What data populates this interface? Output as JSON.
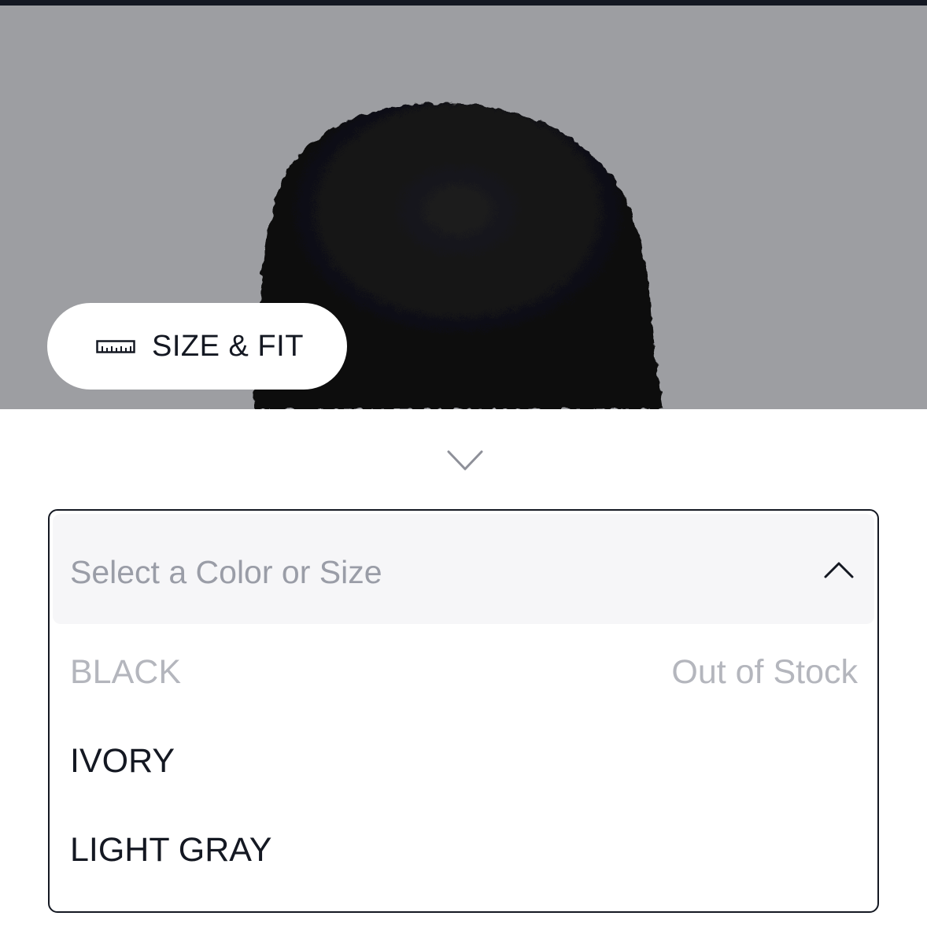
{
  "product": {
    "image_alt": "black boucle beanie",
    "size_fit_label": "SIZE & FIT",
    "size_fit_icon": "ruler-icon"
  },
  "selector": {
    "collapse_icon": "chevron-down-icon",
    "placeholder": "Select a Color or Size",
    "toggle_icon": "chevron-up-icon",
    "options": [
      {
        "label": "BLACK",
        "status": "Out of Stock",
        "available": false
      },
      {
        "label": "IVORY",
        "status": "",
        "available": true
      },
      {
        "label": "LIGHT GRAY",
        "status": "",
        "available": true
      }
    ]
  },
  "colors": {
    "text_primary": "#141822",
    "text_muted": "#b4b6bd",
    "placeholder": "#9a9da7",
    "image_background": "#9d9ea2",
    "header_background": "#f6f6f8"
  }
}
